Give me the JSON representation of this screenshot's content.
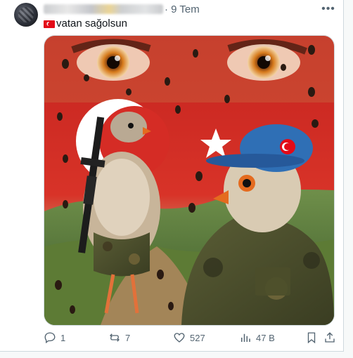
{
  "post": {
    "author_name": "",
    "date": "· 9 Tem",
    "more_icon": "more-horizontal-icon",
    "text": "vatan sağolsun",
    "flag_emoji": "turkey-flag-emoji"
  },
  "actions": {
    "reply_count": "1",
    "repost_count": "7",
    "like_count": "527",
    "views_count": "47 B",
    "icons": [
      "reply-icon",
      "repost-icon",
      "like-icon",
      "views-icon",
      "bookmark-icon",
      "share-icon"
    ]
  },
  "colors": {
    "text_secondary": "#536471",
    "flag_red": "#e30a17",
    "beret_blue": "#2f6fb5"
  }
}
